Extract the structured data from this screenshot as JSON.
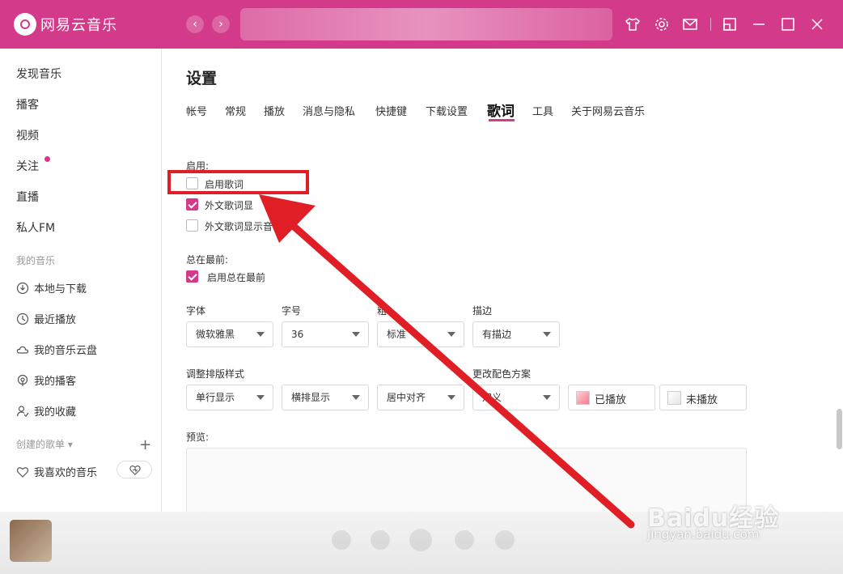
{
  "app": {
    "title": "网易云音乐"
  },
  "sidebar": {
    "items": [
      "发现音乐",
      "播客",
      "视频",
      "关注",
      "直播",
      "私人FM"
    ],
    "section_my_music": "我的音乐",
    "my_music": [
      "本地与下载",
      "最近播放",
      "我的音乐云盘",
      "我的播客",
      "我的收藏"
    ],
    "section_playlists": "创建的歌单",
    "liked": "我喜欢的音乐"
  },
  "settings": {
    "title": "设置",
    "tabs": [
      "帐号",
      "常规",
      "播放",
      "消息与隐私",
      "快捷键",
      "下载设置",
      "歌词",
      "工具",
      "关于网易云音乐"
    ],
    "active_tab": "歌词",
    "enable_label": "启用:",
    "enable_lyrics": "启用歌词",
    "foreign_display": "外文歌词显",
    "foreign_phonetic": "外文歌词显示音译",
    "always_on_top_label": "总在最前:",
    "always_on_top": "启用总在最前",
    "font_label": "字体",
    "font_value": "微软雅黑",
    "size_label": "字号",
    "size_value": "36",
    "weight_label": "粗",
    "weight_value": "标准",
    "stroke_label": "描边",
    "stroke_value": "有描边",
    "layout_label": "调整排版样式",
    "layout_value1": "单行显示",
    "layout_value2": "横排显示",
    "layout_value3": "居中对齐",
    "color_label": "更改配色方案",
    "color_value": "定义",
    "played": "已播放",
    "unplayed": "未播放",
    "preview_label": "预览:"
  },
  "watermark": {
    "main": "Baidu经验",
    "sub": "jingyan.baidu.com"
  },
  "colors": {
    "brand": "#d33a8a",
    "annotation": "#e01e25"
  }
}
